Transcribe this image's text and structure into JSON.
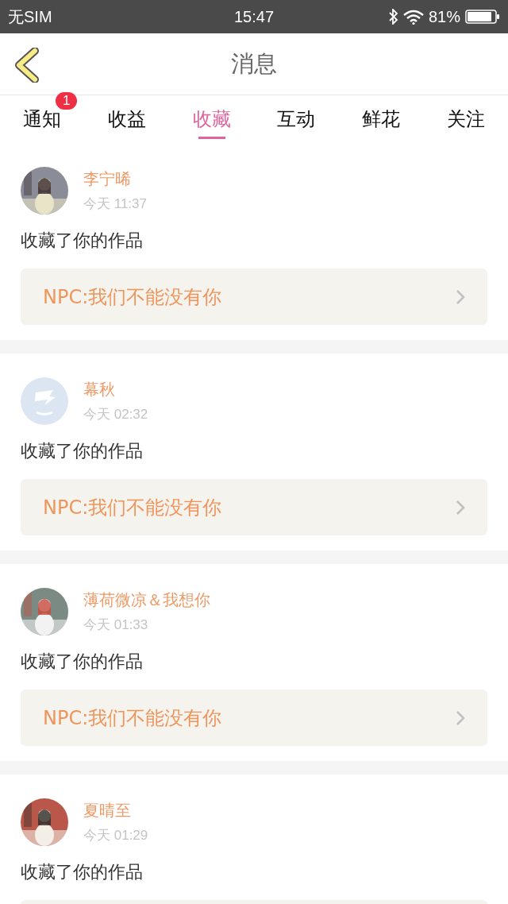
{
  "status_bar": {
    "carrier": "无SIM",
    "time": "15:47",
    "battery": "81%"
  },
  "nav": {
    "title": "消息"
  },
  "tabs": [
    {
      "label": "通知",
      "selected": false,
      "badge": "1"
    },
    {
      "label": "收益",
      "selected": false
    },
    {
      "label": "收藏",
      "selected": true
    },
    {
      "label": "互动",
      "selected": false
    },
    {
      "label": "鲜花",
      "selected": false
    },
    {
      "label": "关注",
      "selected": false
    }
  ],
  "messages": [
    {
      "name": "李宁晞",
      "time": "今天 11:37",
      "text": "收藏了你的作品",
      "work": "NPC:我们不能没有你"
    },
    {
      "avatar": {
        "kind": "default"
      },
      "name": "幕秋",
      "time": "今天 02:32",
      "text": "收藏了你的作品",
      "work": "NPC:我们不能没有你"
    },
    {
      "name": "薄荷微凉＆我想你",
      "time": "今天 01:33",
      "text": "收藏了你的作品",
      "work": "NPC:我们不能没有你"
    },
    {
      "name": "夏晴至",
      "time": "今天 01:29",
      "text": "收藏了你的作品"
    }
  ]
}
